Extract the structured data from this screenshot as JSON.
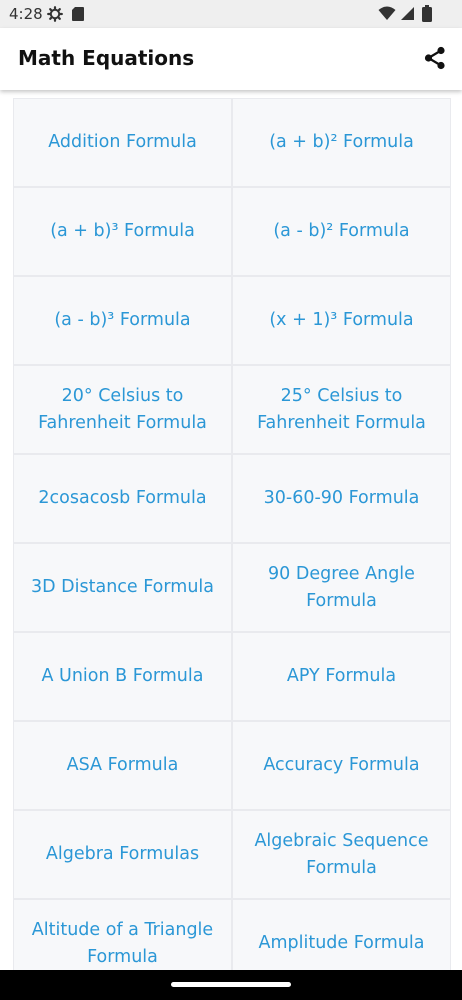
{
  "status_bar": {
    "time": "4:28",
    "left_icons": [
      "gear-icon",
      "sd-card-icon"
    ],
    "right_icons": [
      "wifi-icon",
      "signal-icon",
      "battery-icon"
    ]
  },
  "app_bar": {
    "title": "Math Equations",
    "share_icon": "share-icon"
  },
  "formulas": [
    "Addition Formula",
    "(a + b)² Formula",
    "(a + b)³ Formula",
    "(a - b)² Formula",
    "(a - b)³ Formula",
    "(x + 1)³ Formula",
    "20° Celsius to Fahrenheit Formula",
    "25° Celsius to Fahrenheit Formula",
    "2cosacosb Formula",
    "30-60-90 Formula",
    "3D Distance Formula",
    "90 Degree Angle Formula",
    "A Union B Formula",
    "APY Formula",
    "ASA Formula",
    "Accuracy Formula",
    "Algebra Formulas",
    "Algebraic Sequence Formula",
    "Altitude of a Triangle Formula",
    "Amplitude Formula"
  ],
  "colors": {
    "link_text": "#2b97d6",
    "cell_background": "#f7f8fa",
    "grid_lines": "#e9eaee",
    "status_bar": "#efefef",
    "nav_bar": "#000000"
  }
}
